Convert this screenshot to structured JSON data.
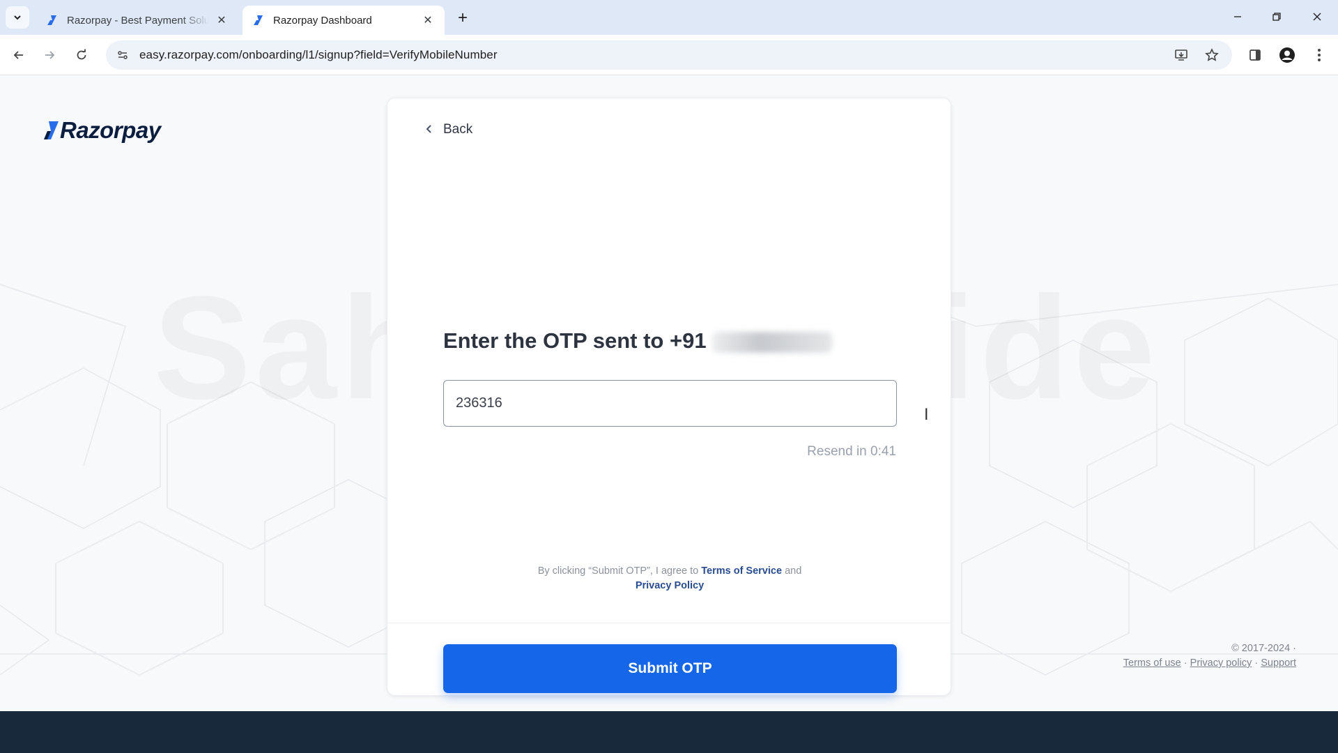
{
  "browser": {
    "tabs": [
      {
        "title": "Razorpay - Best Payment Solutions",
        "active": false
      },
      {
        "title": "Razorpay Dashboard",
        "active": true
      }
    ],
    "url": "easy.razorpay.com/onboarding/l1/signup?field=VerifyMobileNumber"
  },
  "brand": {
    "logo_text": "Razorpay",
    "primary_color": "#1566e8",
    "logo_color": "#0b1e3f"
  },
  "watermark": "Sahil R Guide",
  "card": {
    "back_label": "Back",
    "heading": "Enter the OTP sent to +91",
    "otp_value": "236316",
    "resend_label": "Resend in 0:41",
    "agree_prefix": "By clicking “Submit OTP”, I agree to",
    "terms_link": "Terms of Service",
    "agree_and": "and",
    "privacy_link": "Privacy Policy",
    "submit_label": "Submit OTP"
  },
  "footer": {
    "copyright": "© 2017-2024 ·",
    "terms_of_use": "Terms of use",
    "privacy_policy": "Privacy policy",
    "support": "Support",
    "separator": "·"
  }
}
